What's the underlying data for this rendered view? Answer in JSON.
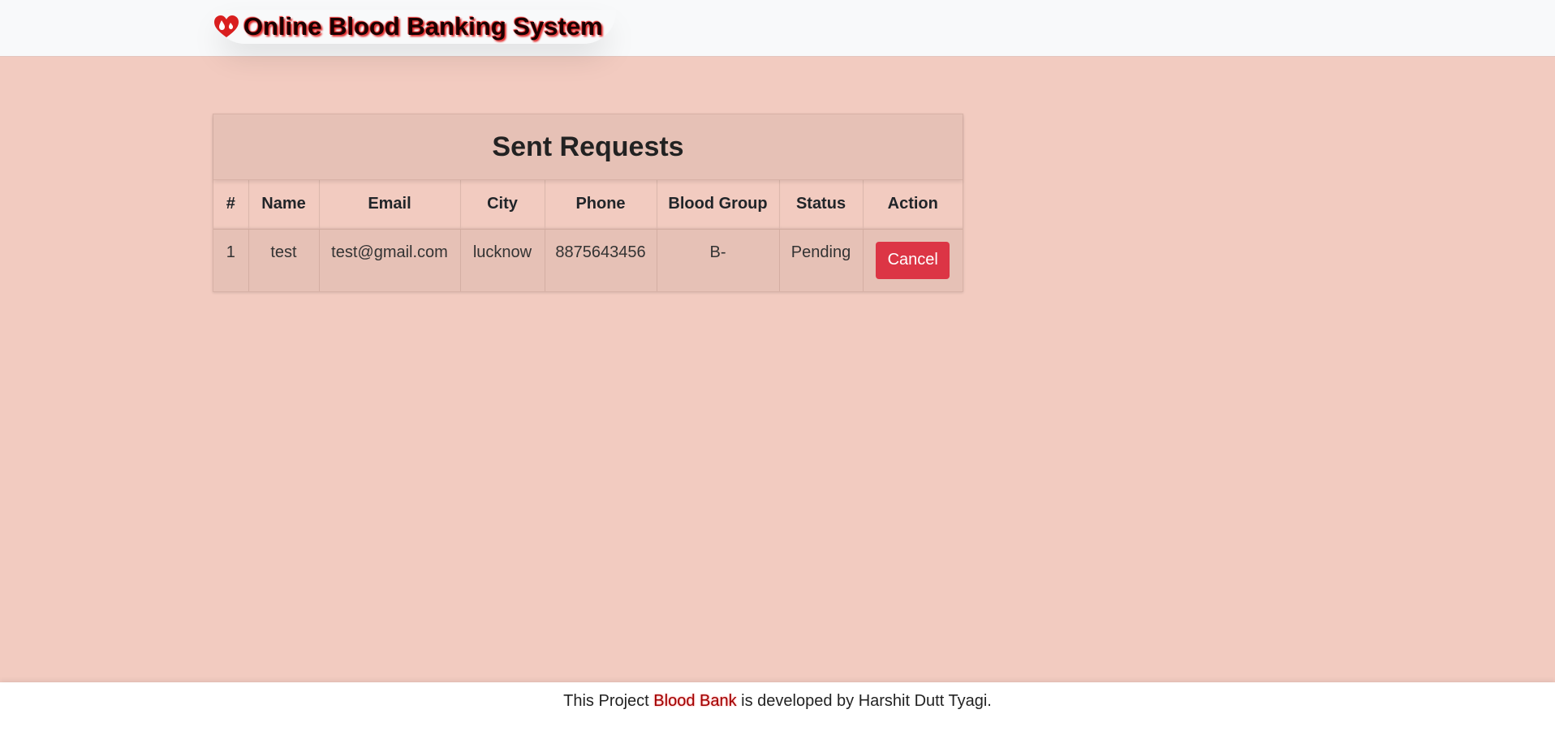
{
  "app": {
    "brand": "Online Blood Banking System",
    "brand_icon": "blood-drops-heart-icon",
    "accent_color": "#dc3545",
    "background_color": "#f2cbc0"
  },
  "card": {
    "title": "Sent Requests"
  },
  "table": {
    "headers": [
      "#",
      "Name",
      "Email",
      "City",
      "Phone",
      "Blood Group",
      "Status",
      "Action"
    ],
    "rows": [
      {
        "index": "1",
        "name": "test",
        "email": "test@gmail.com",
        "city": "lucknow",
        "phone": "8875643456",
        "blood_group": "B-",
        "status": "Pending",
        "action_label": "Cancel"
      }
    ]
  },
  "footer": {
    "prefix": "This Project ",
    "highlight": "Blood Bank",
    "suffix": " is developed by Harshit Dutt Tyagi."
  }
}
